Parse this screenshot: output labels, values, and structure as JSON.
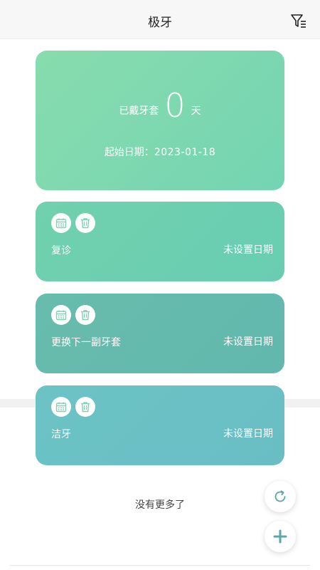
{
  "header": {
    "title": "极牙"
  },
  "summary": {
    "wear_label": "已戴牙套",
    "wear_count": "0",
    "wear_unit": "天",
    "start_label": "起始日期：",
    "start_date": "2023-01-18"
  },
  "items": [
    {
      "name": "复诊",
      "date": "未设置日期"
    },
    {
      "name": "更换下一副牙套",
      "date": "未设置日期"
    },
    {
      "name": "洁牙",
      "date": "未设置日期"
    }
  ],
  "footer": {
    "no_more": "没有更多了"
  },
  "colors": {
    "hero": "#7fd8b0",
    "item1": "#6dcfb0",
    "item2": "#65baad",
    "item3": "#6ac1c4",
    "icon": "#7fd3b0",
    "fab_icon": "#5aa7a5"
  }
}
